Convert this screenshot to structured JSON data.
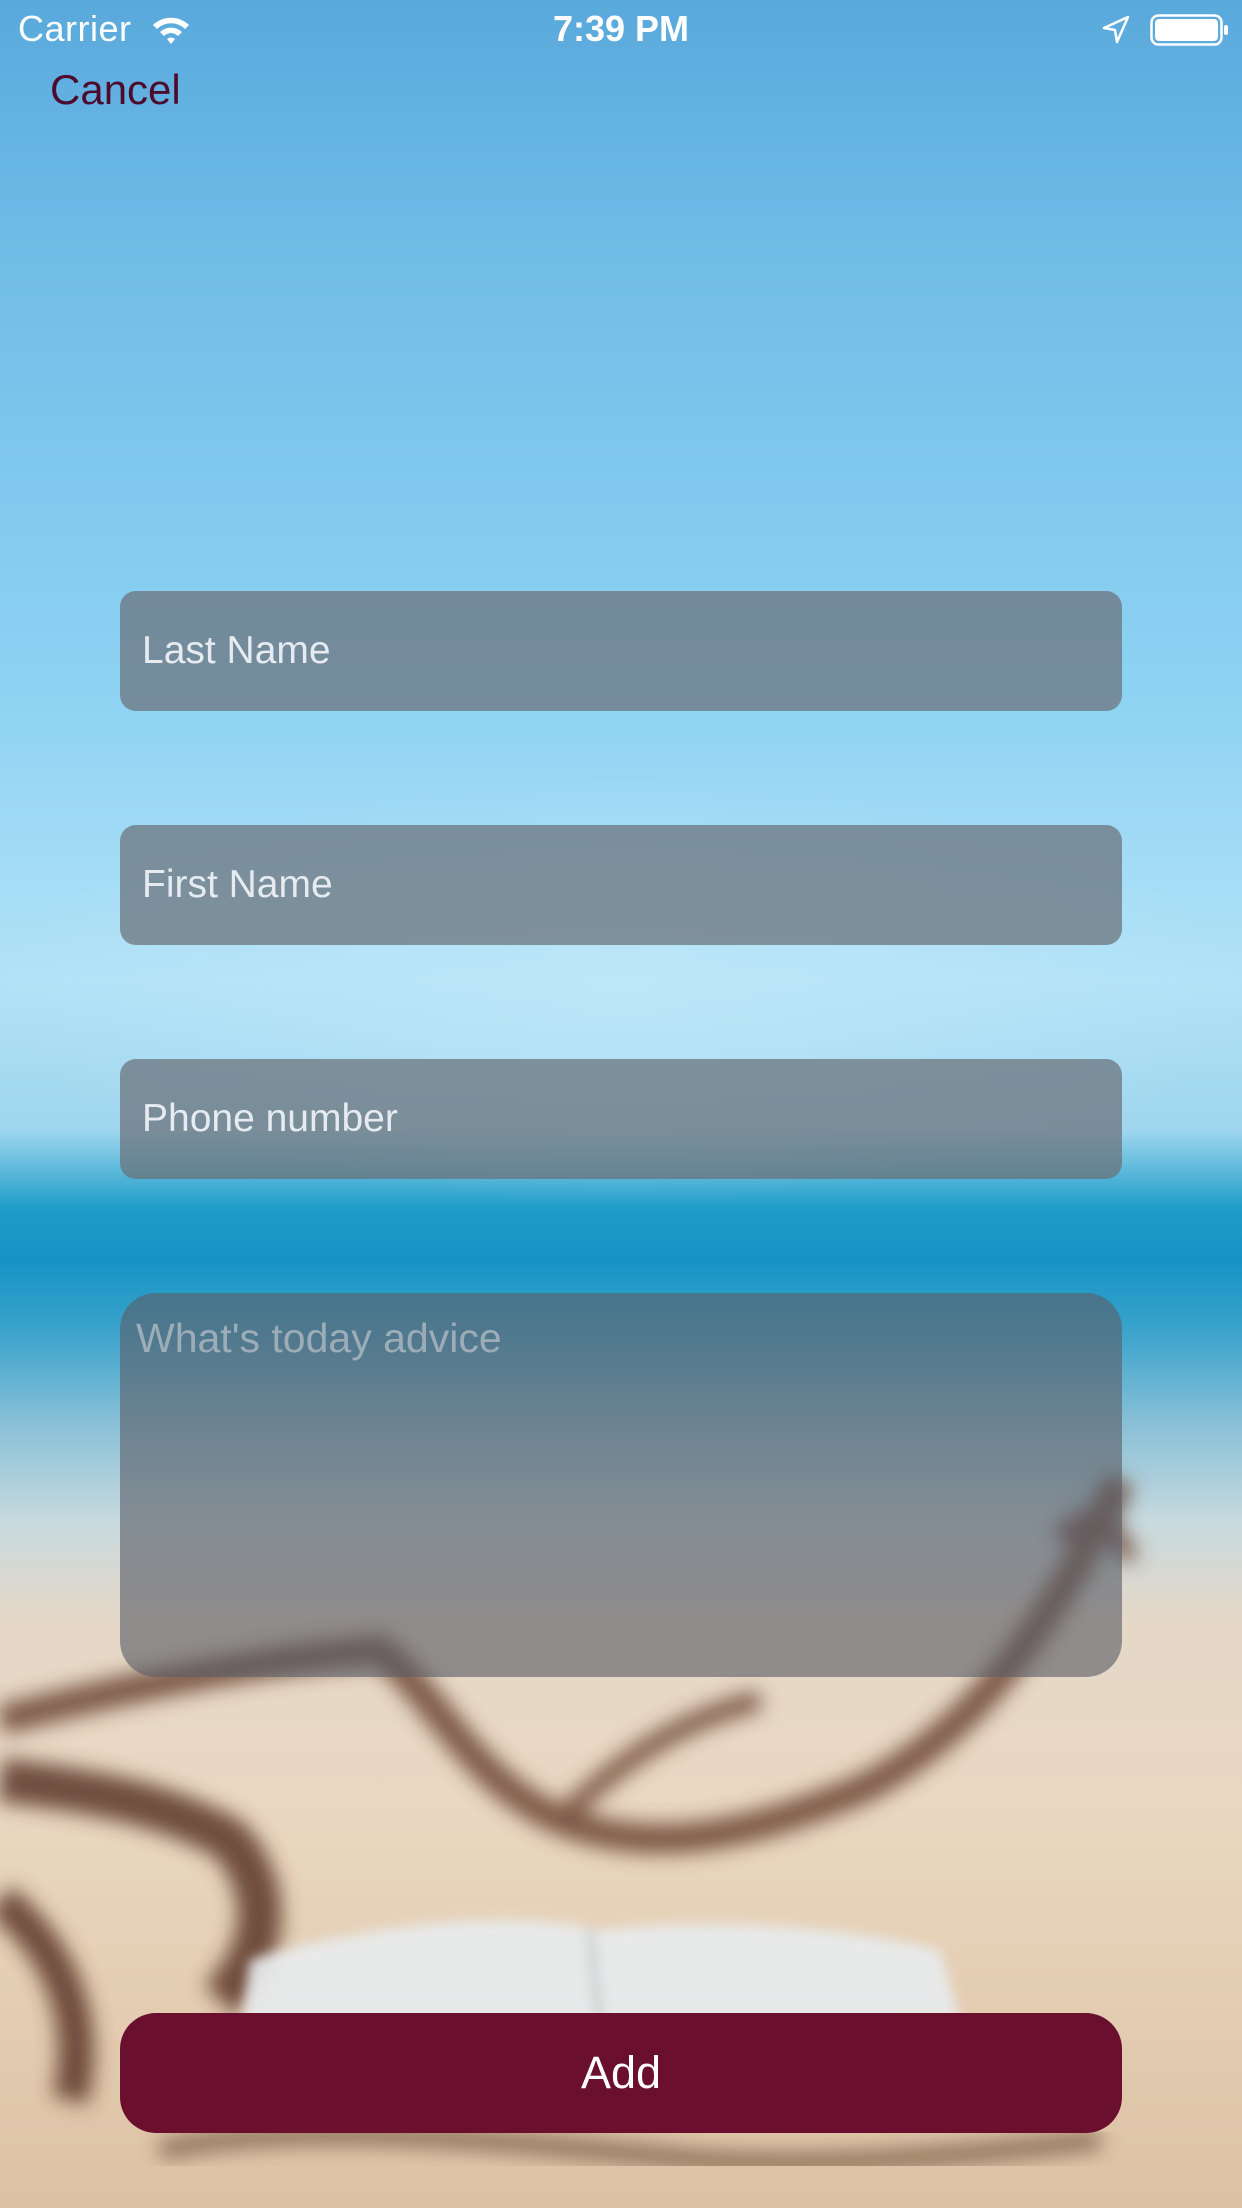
{
  "status_bar": {
    "carrier": "Carrier",
    "time": "7:39 PM",
    "wifi_icon": "wifi-icon",
    "location_icon": "location-arrow-icon",
    "battery_icon": "battery-full-icon"
  },
  "nav": {
    "cancel_label": "Cancel"
  },
  "form": {
    "last_name_placeholder": "Last Name",
    "first_name_placeholder": "First Name",
    "phone_placeholder": "Phone number",
    "advice_placeholder": "What's today advice",
    "add_label": "Add"
  },
  "colors": {
    "accent": "#6b0f2f",
    "cancel_text": "#4d0b2e",
    "field_background": "#69707a"
  }
}
